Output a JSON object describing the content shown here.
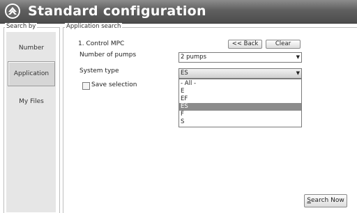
{
  "title": "Standard configuration",
  "search_by": {
    "legend": "Search by",
    "items": [
      {
        "label": "Number",
        "active": false
      },
      {
        "label": "Application",
        "active": true
      },
      {
        "label": "My Files",
        "active": false
      }
    ]
  },
  "application_search": {
    "legend": "Application search",
    "step_label": "1. Control MPC",
    "back_label": "<< Back",
    "clear_label": "Clear",
    "pumps_label": "Number of pumps",
    "pumps_value": "2 pumps",
    "system_type_label": "System type",
    "system_type_value": "ES",
    "save_selection_label": "Save selection",
    "save_selection_checked": false,
    "system_type_options": [
      "- All -",
      "E",
      "EF",
      "ES",
      "F",
      "S"
    ],
    "system_type_selected": "ES",
    "search_now_prefix": "S",
    "search_now_rest": "earch Now"
  },
  "colors": {
    "titlebar": "#5f5f5f",
    "selection": "#8c8c8c",
    "panel": "#e6e6e6"
  }
}
